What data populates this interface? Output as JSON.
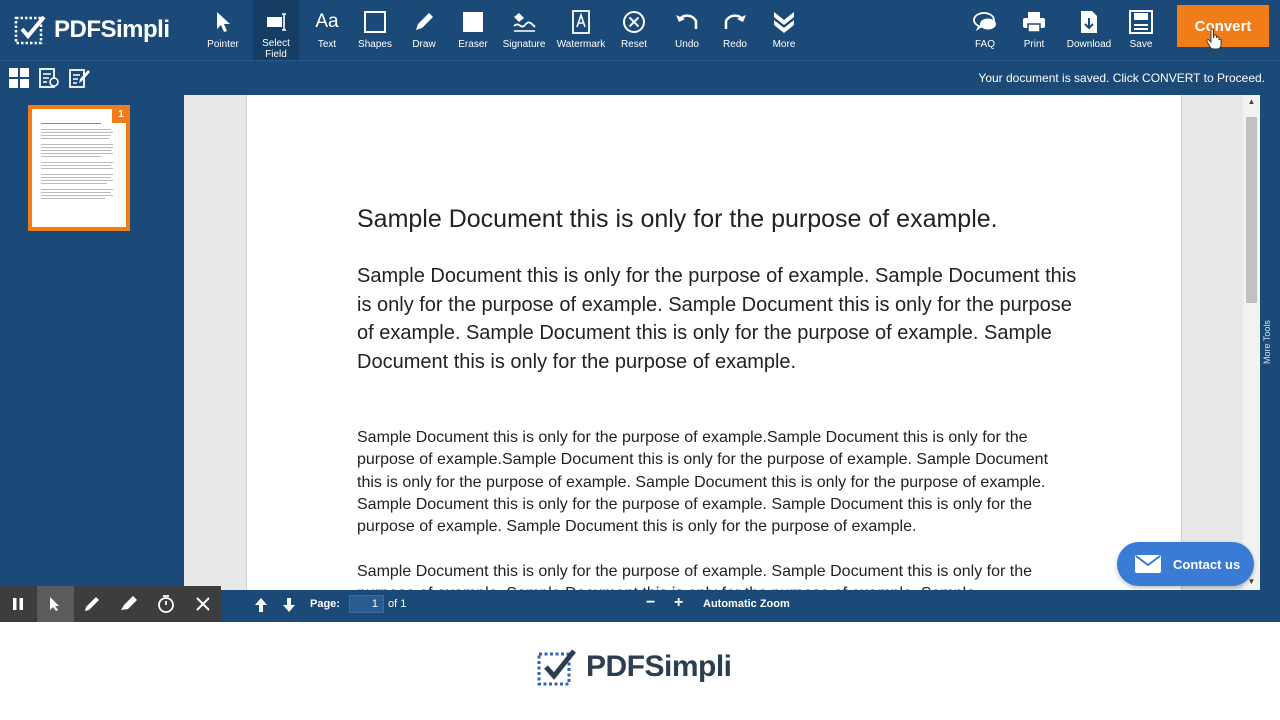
{
  "app": {
    "brand": "PDFSimpli"
  },
  "toolbar": {
    "tools": [
      {
        "label": "Pointer",
        "icon": "pointer-icon"
      },
      {
        "label": "Select\nField",
        "icon": "select-field-icon"
      },
      {
        "label": "Text",
        "icon": "text-icon"
      },
      {
        "label": "Shapes",
        "icon": "shapes-icon"
      },
      {
        "label": "Draw",
        "icon": "draw-icon"
      },
      {
        "label": "Eraser",
        "icon": "eraser-icon"
      },
      {
        "label": "Signature",
        "icon": "signature-icon"
      },
      {
        "label": "Watermark",
        "icon": "watermark-icon"
      },
      {
        "label": "Reset",
        "icon": "reset-icon"
      },
      {
        "label": "Undo",
        "icon": "undo-icon"
      },
      {
        "label": "Redo",
        "icon": "redo-icon"
      },
      {
        "label": "More",
        "icon": "more-icon"
      }
    ],
    "right_tools": [
      {
        "label": "FAQ",
        "icon": "faq-icon"
      },
      {
        "label": "Print",
        "icon": "print-icon"
      },
      {
        "label": "Download",
        "icon": "download-icon"
      },
      {
        "label": "Save",
        "icon": "save-icon"
      }
    ],
    "text_icon_glyph": "Aa",
    "convert_label": "Convert"
  },
  "subbar": {
    "saved_message": "Your document is saved. Click CONVERT to Proceed."
  },
  "sidebar": {
    "page_badge": "1"
  },
  "document": {
    "title": "Sample Document this is only for the purpose of example.",
    "p1": "Sample Document this is only for the purpose of example. Sample Document this is only for the purpose of example. Sample Document this is only for the purpose of example. Sample Document this is only for the purpose of example. Sample Document this is only for the purpose of example.",
    "p2": "Sample Document this is only for the purpose of example.Sample Document this is only for the purpose of example.Sample Document this is only for the purpose of example. Sample Document this is only for the purpose of example. Sample Document this is only for the purpose of example. Sample Document this is only for the purpose of example. Sample Document this is only for the purpose of example. Sample Document this is only for the purpose of example.",
    "p3": "Sample Document this is only for the purpose of example. Sample Document this is only for the purpose of example. Sample Document this is only for the purpose of example. Sample"
  },
  "side_tab": {
    "label": "More Tools"
  },
  "contact": {
    "label": "Contact us"
  },
  "pager": {
    "page_label": "Page:",
    "current_page": "1",
    "total_text": "of 1",
    "zoom_minus": "−",
    "zoom_plus": "+",
    "zoom_label": "Automatic Zoom"
  },
  "footer": {
    "brand": "PDFSimpli"
  },
  "colors": {
    "primary": "#1b4a78",
    "accent": "#f07d1a",
    "contact": "#3a7bd5"
  }
}
